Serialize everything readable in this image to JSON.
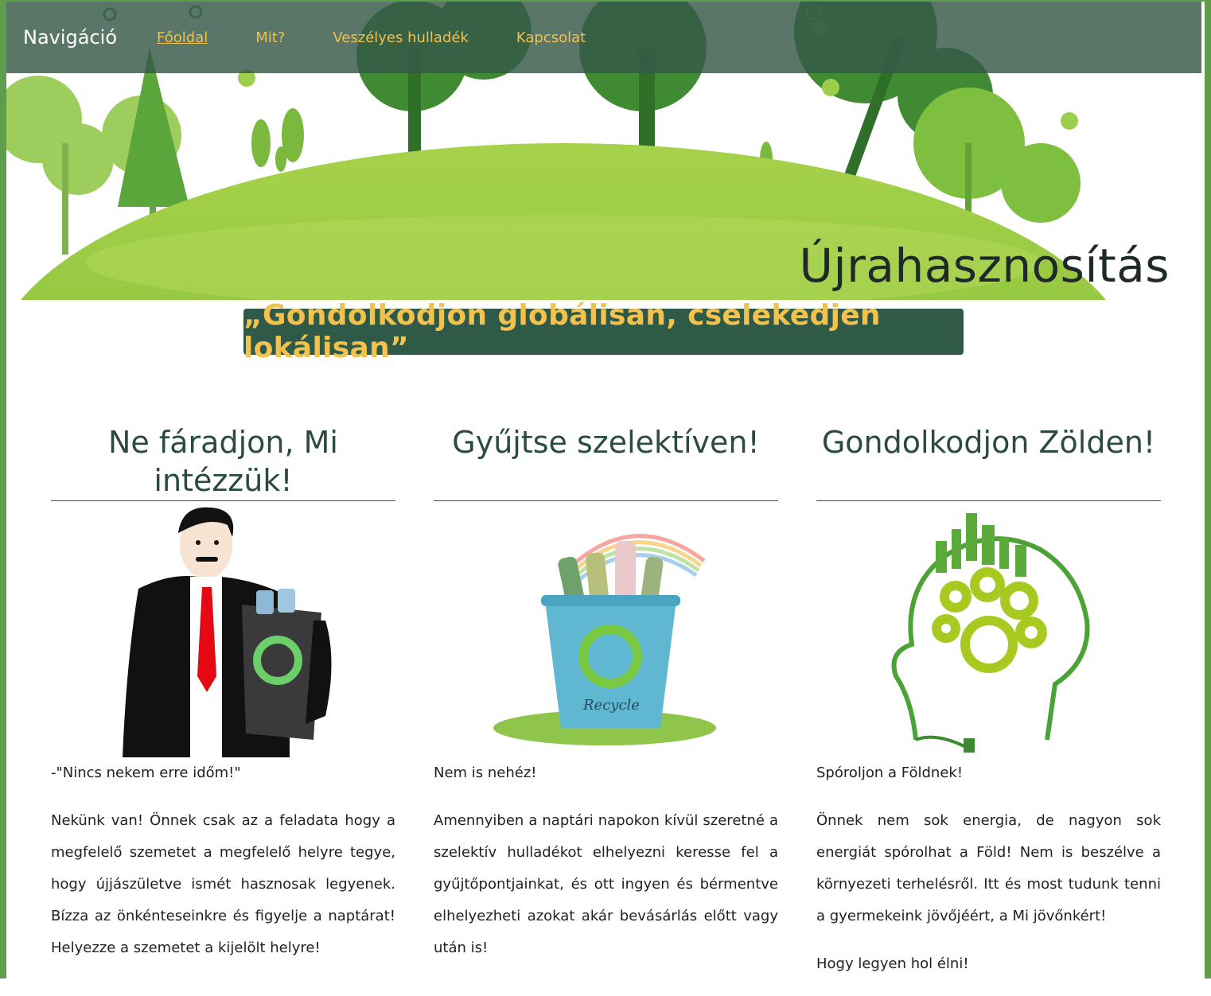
{
  "nav": {
    "brand": "Navigáció",
    "links": [
      "Főoldal",
      "Mit?",
      "Veszélyes hulladék",
      "Kapcsolat"
    ]
  },
  "hero": {
    "title": "Újrahasznosítás"
  },
  "slogan": "„Gondolkodjon globálisan, cselekedjen lokálisan”",
  "columns": [
    {
      "heading": "Ne fáradjon, Mi intézzük!",
      "lead": "-\"Nincs nekem erre időm!\"",
      "body": "Nekünk van! Önnek csak az a feladata hogy a megfelelő szemetet a megfelelő helyre tegye, hogy újjászületve ismét hasznosak legyenek. Bízza az önkénteseinkre és figyelje a naptárat! Helyezze a szemetet a kijelölt helyre!"
    },
    {
      "heading": "Gyűjtse szelektíven!",
      "lead": "Nem is nehéz!",
      "body": "Amennyiben a naptári napokon kívül szeretné a szelektív hulladékot elhelyezni keresse fel a gyűjtőpontjainkat, és ott ingyen és bérmentve elhelyezheti azokat akár bevásárlás előtt vagy után is!",
      "image_text": "Recycle"
    },
    {
      "heading": "Gondolkodjon Zölden!",
      "lead": "Spóroljon a Földnek!",
      "body": "Önnek nem sok energia, de nagyon sok energiát spórolhat a Föld! Nem is beszélve a környezeti terhelésről. Itt és most tudunk tenni a gyermekeink jövőjéért, a Mi jövőnkért!",
      "extra": "Hogy legyen hol élni!"
    }
  ],
  "colors": {
    "accent": "#f2c14e",
    "dark_green": "#2f5a48",
    "navbar": "#345848",
    "frame": "#5e9e4a"
  }
}
